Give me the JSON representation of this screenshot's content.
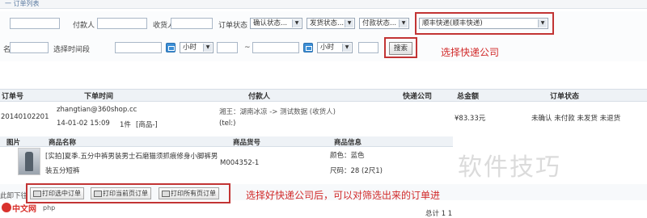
{
  "header": {
    "title": "一 订单列表"
  },
  "filters": {
    "payer_label": "付款人",
    "receiver_label": "收货人",
    "order_status_label": "订单状态",
    "confirm_status": "确认状态...",
    "ship_status": "发货状态...",
    "pay_status": "付款状态...",
    "express_company": "顺丰快递(顺丰快递)",
    "name_label": "名",
    "time_label": "选择时间段",
    "hour_start": "小时",
    "tilde": "~",
    "hour_end": "小时",
    "search_button": "搜索"
  },
  "annotations": {
    "select_express": "选择快递公司",
    "after_select": "选择好快递公司后，可以对筛选出来的订单进"
  },
  "table": {
    "headers": {
      "order_no": "订单号",
      "order_time": "下单时间",
      "payer": "付款人",
      "express": "快递公司",
      "total": "总金额",
      "status": "订单状态"
    },
    "row": {
      "order_no": "20140102201",
      "email": "zhangtian@360shop.cc",
      "datetime": "14-01-02 15:09",
      "pieces": "1件",
      "goods": "[商品-]",
      "address": "湘王：湖南冰凉 -> 测试数据 (收货人)",
      "tel": "(tel:)",
      "total": "¥83.33元",
      "status": "未确认 未付款 未发货 未退货"
    }
  },
  "products": {
    "headers": {
      "image": "图片",
      "name": "商品名称",
      "sku": "商品货号",
      "info": "商品信息"
    },
    "item": {
      "name_line1": "[实拍]夏季.五分中裤男装男士石磨猫须抓痕修身小脚裤男",
      "name_line2": "装五分短裤",
      "sku": "M004352-1",
      "color": "颜色：蓝色",
      "size": "尺码：28 (2尺1)"
    }
  },
  "actions": {
    "left_label": "此卸下往",
    "print_selected": "打印选中订单",
    "print_current": "打印当前页订单",
    "print_all": "打印所有页订单",
    "total": "总计 1 1"
  },
  "watermark": {
    "text": "软件技巧"
  },
  "logo": {
    "main": "中文网",
    "sub": "php"
  }
}
